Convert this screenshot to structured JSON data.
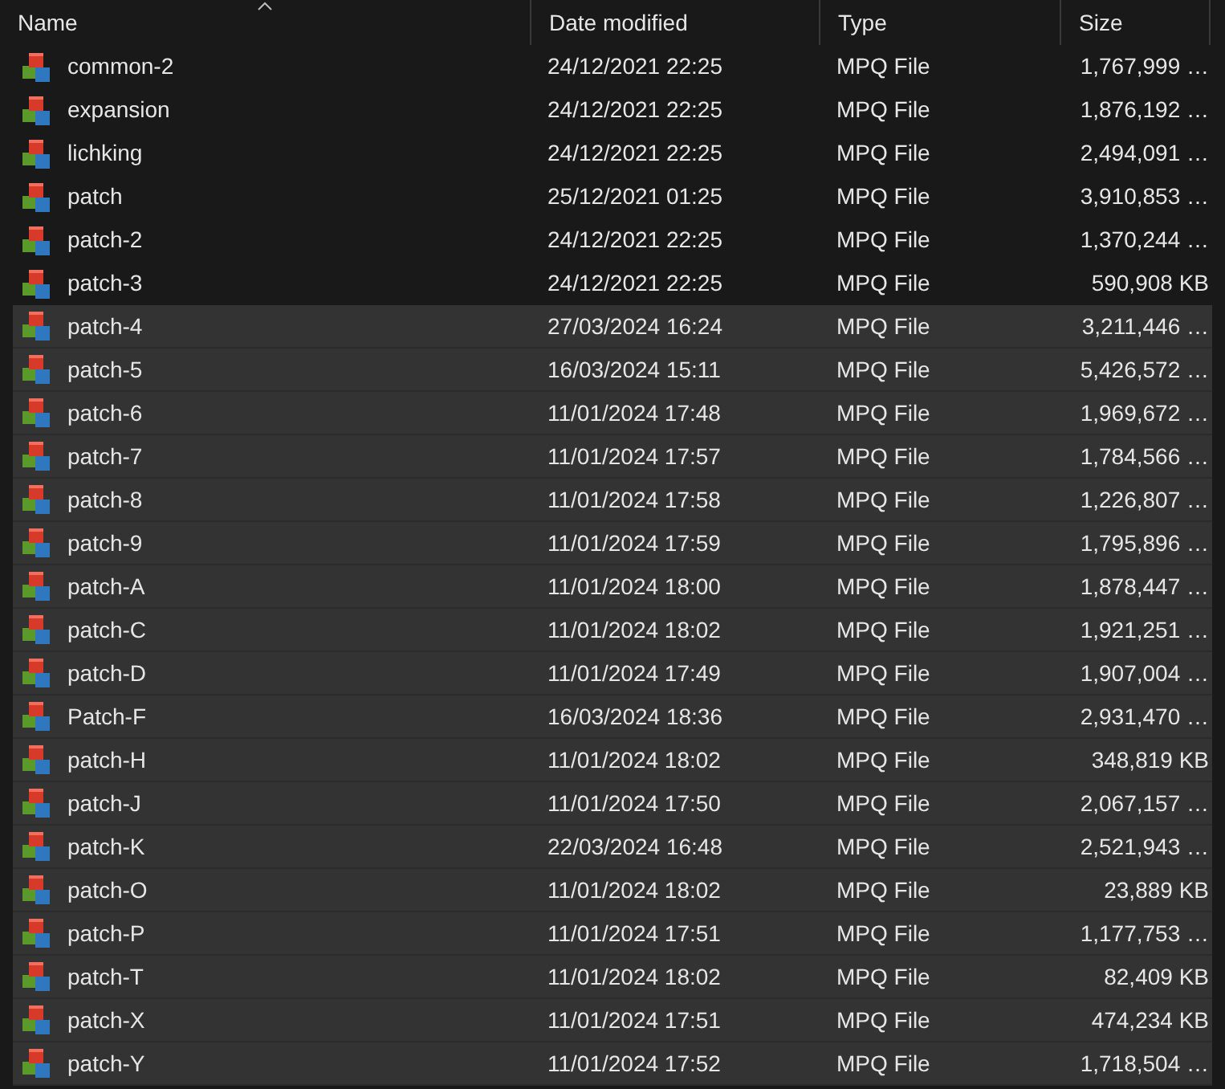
{
  "columns": [
    {
      "label": "Name",
      "sorted": true
    },
    {
      "label": "Date modified",
      "sorted": false
    },
    {
      "label": "Type",
      "sorted": false
    },
    {
      "label": "Size",
      "sorted": false
    }
  ],
  "rows": [
    {
      "name": "common-2",
      "date": "24/12/2021 22:25",
      "type": "MPQ File",
      "size": "1,767,999 …",
      "selected": false
    },
    {
      "name": "expansion",
      "date": "24/12/2021 22:25",
      "type": "MPQ File",
      "size": "1,876,192 …",
      "selected": false
    },
    {
      "name": "lichking",
      "date": "24/12/2021 22:25",
      "type": "MPQ File",
      "size": "2,494,091 …",
      "selected": false
    },
    {
      "name": "patch",
      "date": "25/12/2021 01:25",
      "type": "MPQ File",
      "size": "3,910,853 …",
      "selected": false
    },
    {
      "name": "patch-2",
      "date": "24/12/2021 22:25",
      "type": "MPQ File",
      "size": "1,370,244 …",
      "selected": false
    },
    {
      "name": "patch-3",
      "date": "24/12/2021 22:25",
      "type": "MPQ File",
      "size": "590,908 KB",
      "selected": false
    },
    {
      "name": "patch-4",
      "date": "27/03/2024 16:24",
      "type": "MPQ File",
      "size": "3,211,446 …",
      "selected": true
    },
    {
      "name": "patch-5",
      "date": "16/03/2024 15:11",
      "type": "MPQ File",
      "size": "5,426,572 …",
      "selected": true
    },
    {
      "name": "patch-6",
      "date": "11/01/2024 17:48",
      "type": "MPQ File",
      "size": "1,969,672 …",
      "selected": true
    },
    {
      "name": "patch-7",
      "date": "11/01/2024 17:57",
      "type": "MPQ File",
      "size": "1,784,566 …",
      "selected": true
    },
    {
      "name": "patch-8",
      "date": "11/01/2024 17:58",
      "type": "MPQ File",
      "size": "1,226,807 …",
      "selected": true
    },
    {
      "name": "patch-9",
      "date": "11/01/2024 17:59",
      "type": "MPQ File",
      "size": "1,795,896 …",
      "selected": true
    },
    {
      "name": "patch-A",
      "date": "11/01/2024 18:00",
      "type": "MPQ File",
      "size": "1,878,447 …",
      "selected": true
    },
    {
      "name": "patch-C",
      "date": "11/01/2024 18:02",
      "type": "MPQ File",
      "size": "1,921,251 …",
      "selected": true
    },
    {
      "name": "patch-D",
      "date": "11/01/2024 17:49",
      "type": "MPQ File",
      "size": "1,907,004 …",
      "selected": true
    },
    {
      "name": "Patch-F",
      "date": "16/03/2024 18:36",
      "type": "MPQ File",
      "size": "2,931,470 …",
      "selected": true
    },
    {
      "name": "patch-H",
      "date": "11/01/2024 18:02",
      "type": "MPQ File",
      "size": "348,819 KB",
      "selected": true
    },
    {
      "name": "patch-J",
      "date": "11/01/2024 17:50",
      "type": "MPQ File",
      "size": "2,067,157 …",
      "selected": true
    },
    {
      "name": "patch-K",
      "date": "22/03/2024 16:48",
      "type": "MPQ File",
      "size": "2,521,943 …",
      "selected": true
    },
    {
      "name": "patch-O",
      "date": "11/01/2024 18:02",
      "type": "MPQ File",
      "size": "23,889 KB",
      "selected": true
    },
    {
      "name": "patch-P",
      "date": "11/01/2024 17:51",
      "type": "MPQ File",
      "size": "1,177,753 …",
      "selected": true
    },
    {
      "name": "patch-T",
      "date": "11/01/2024 18:02",
      "type": "MPQ File",
      "size": "82,409 KB",
      "selected": true
    },
    {
      "name": "patch-X",
      "date": "11/01/2024 17:51",
      "type": "MPQ File",
      "size": "474,234 KB",
      "selected": true
    },
    {
      "name": "patch-Y",
      "date": "11/01/2024 17:52",
      "type": "MPQ File",
      "size": "1,718,504 …",
      "selected": true
    }
  ]
}
